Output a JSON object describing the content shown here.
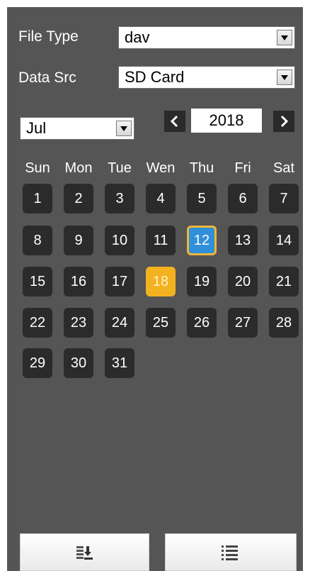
{
  "filters": {
    "file_type_label": "File Type",
    "file_type_value": "dav",
    "data_src_label": "Data Src",
    "data_src_value": "SD Card"
  },
  "calendar": {
    "month": "Jul",
    "year": "2018",
    "prev_glyph": "<",
    "next_glyph": ">",
    "weekdays": [
      "Sun",
      "Mon",
      "Tue",
      "Wen",
      "Thu",
      "Fri",
      "Sat"
    ],
    "days": [
      "1",
      "2",
      "3",
      "4",
      "5",
      "6",
      "7",
      "8",
      "9",
      "10",
      "11",
      "12",
      "13",
      "14",
      "15",
      "16",
      "17",
      "18",
      "19",
      "20",
      "21",
      "22",
      "23",
      "24",
      "25",
      "26",
      "27",
      "28",
      "29",
      "30",
      "31"
    ],
    "selected_day": "12",
    "highlighted_day": "18",
    "first_weekday_index": 0
  },
  "colors": {
    "panel_bg": "#555555",
    "day_bg": "#2b2b2b",
    "selected_bg": "#2f8fd8",
    "selected_border": "#f0b53a",
    "highlight_bg": "#f3b21f"
  },
  "icons": {
    "download": "download-icon",
    "list": "list-icon"
  }
}
